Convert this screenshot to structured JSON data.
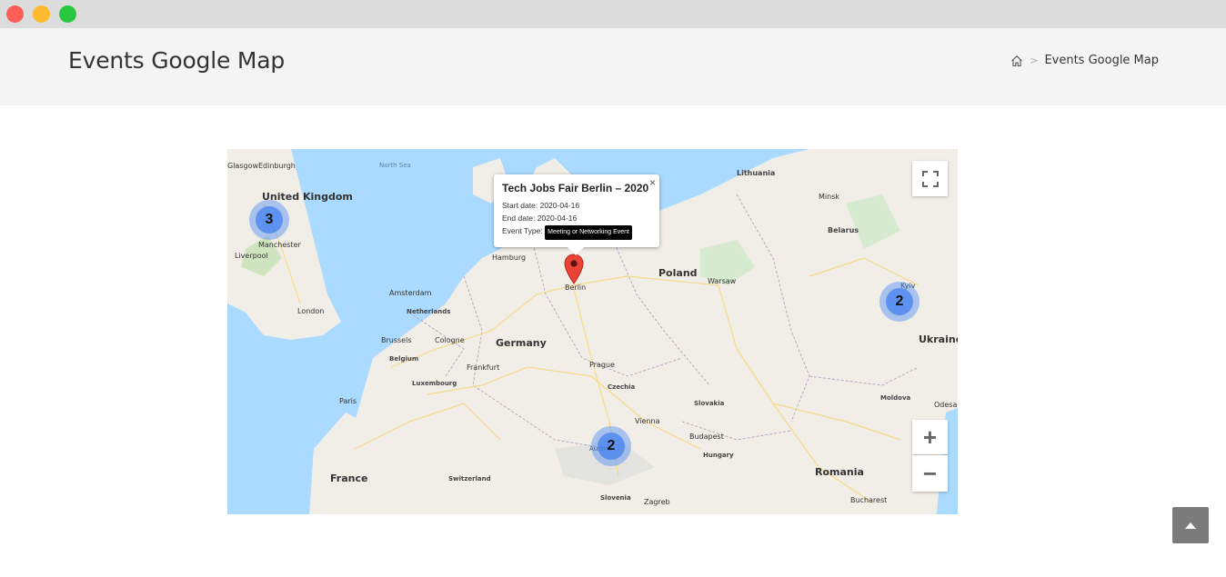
{
  "page": {
    "title": "Events Google Map",
    "breadcrumb": {
      "home_icon": "home-icon",
      "separator": ">",
      "current": "Events Google Map"
    }
  },
  "map": {
    "labels": {
      "countries": [
        "United Kingdom",
        "Netherlands",
        "Belgium",
        "Luxembourg",
        "Germany",
        "Poland",
        "Czechia",
        "Slovakia",
        "Hungary",
        "Austria",
        "Slovenia",
        "Switzerland",
        "France",
        "Belarus",
        "Ukraine",
        "Romania",
        "Moldova",
        "Lithuania"
      ],
      "cities": [
        "Glasgow",
        "Edinburgh",
        "Manchester",
        "Liverpool",
        "London",
        "Amsterdam",
        "Brussels",
        "Cologne",
        "Frankfurt",
        "Hamburg",
        "Berlin",
        "Warsaw",
        "Prague",
        "Vienna",
        "Budapest",
        "Paris",
        "Zagreb",
        "Minsk",
        "Kyiv",
        "Odesa",
        "Bucharest"
      ],
      "sea": "North Sea"
    },
    "clusters": [
      {
        "count": "3"
      },
      {
        "count": "2"
      },
      {
        "count": "2"
      }
    ],
    "infowindow": {
      "title": "Tech Jobs Fair Berlin – 2020",
      "start_label": "Start date:",
      "start_date": "2020-04-16",
      "end_label": "End date:",
      "end_date": "2020-04-16",
      "type_label": "Event Type:",
      "type_value": "Meeting or Networking Event",
      "close": "×"
    },
    "controls": {
      "zoom_in": "+",
      "zoom_out": "−"
    }
  },
  "colors": {
    "water": "#aadaff",
    "land": "#f1eee7",
    "cluster": "#4c8cf5",
    "marker": "#ea4335",
    "header_bg": "#f4f4f4"
  }
}
